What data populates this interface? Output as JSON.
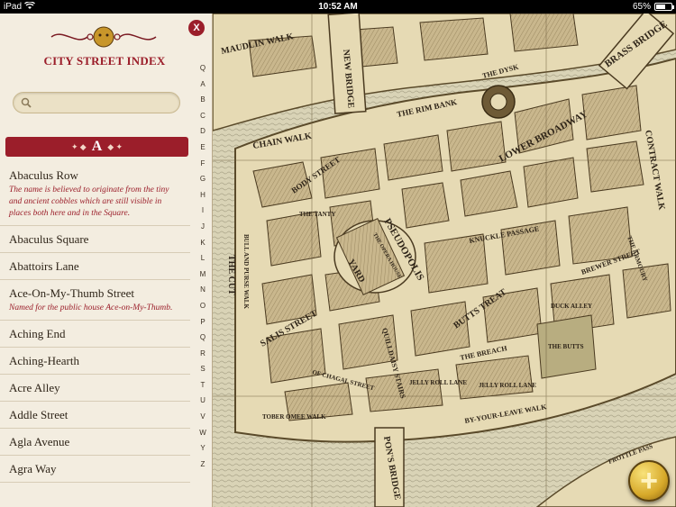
{
  "status": {
    "carrier": "iPad",
    "time": "10:52 AM",
    "battery": "65%",
    "battery_level": 0.65
  },
  "sidebar": {
    "close_label": "X",
    "title": "CITY STREET INDEX",
    "search": {
      "placeholder": "",
      "value": ""
    },
    "section_letter": "A",
    "index_letters": [
      "Q",
      "A",
      "B",
      "C",
      "D",
      "E",
      "F",
      "G",
      "H",
      "I",
      "J",
      "K",
      "L",
      "M",
      "N",
      "O",
      "P",
      "Q",
      "R",
      "S",
      "T",
      "U",
      "V",
      "W",
      "Y",
      "Z"
    ],
    "items": [
      {
        "name": "Abaculus Row",
        "note": "The name is believed to originate from the tiny and ancient cobbles which are still visible in places both here and in the Square."
      },
      {
        "name": "Abaculus Square",
        "note": ""
      },
      {
        "name": "Abattoirs Lane",
        "note": ""
      },
      {
        "name": "Ace-On-My-Thumb Street",
        "note": "Named for the public house Ace-on-My-Thumb."
      },
      {
        "name": "Aching End",
        "note": ""
      },
      {
        "name": "Aching-Hearth",
        "note": ""
      },
      {
        "name": "Acre Alley",
        "note": ""
      },
      {
        "name": "Addle Street",
        "note": ""
      },
      {
        "name": "Agla Avenue",
        "note": ""
      },
      {
        "name": "Agra Way",
        "note": ""
      }
    ]
  },
  "map": {
    "labels": {
      "maudlin_walk": "MAUDLIN WALK",
      "new_bridge": "NEW BRIDGE",
      "rim_bank": "THE RIM BANK",
      "dysk": "THE DYSK",
      "brass_bridge": "BRASS BRIDGE",
      "lower_broadway": "LOWER BROADWAY",
      "contract_walk": "CONTRACT WALK",
      "chain_walk": "CHAIN WALK",
      "body_street": "BODY STREET",
      "tanty": "THE TANTY",
      "pseudopolis": "PSEUDOPOLIS",
      "yard": "YARD",
      "opera_house": "THE OPERA HOUSE",
      "knuckle_passage": "KNUCKLE PASSAGE",
      "brewer_street": "BREWER STREET",
      "armoury": "THE ARMOURY",
      "the_cut": "THE CUT",
      "bull_and_purse_walk": "BULL AND PURSE WALK",
      "salis_street": "SALIS STREET",
      "butts_treat": "BUTTS TREAT",
      "the_butts": "THE BUTTS",
      "the_breach": "THE BREACH",
      "quilldaisy_stairs": "QUILLDAISY STAIRS",
      "jelly_roll_lane": "JELLY ROLL LANE",
      "jelly_roll_lane_2": "JELLY ROLL LANE",
      "by_your_leave_walk": "BY-YOUR-LEAVE WALK",
      "tober_omee_walk": "TOBER OMEE WALK",
      "pons_bridge": "PON'S BRIDGE",
      "of_chagal_street": "OF CHAGAL STREET",
      "duck_alley": "DUCK ALLEY",
      "frottle_pass": "FROTTLE PASS"
    }
  },
  "fab": {
    "label": "+"
  }
}
